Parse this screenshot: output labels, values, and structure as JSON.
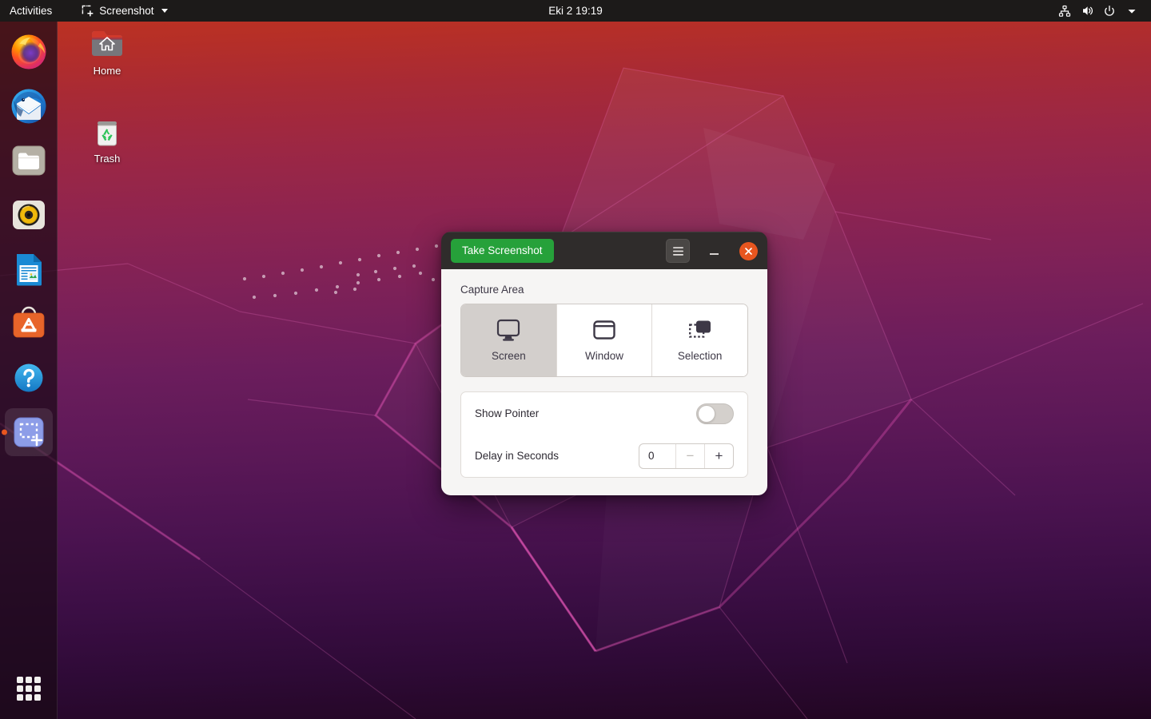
{
  "topbar": {
    "activities_label": "Activities",
    "app_menu_label": "Screenshot",
    "app_menu_icon": "selection-crosshair-icon",
    "clock_label": "Eki 2  19:19",
    "tray_icons": [
      "network-wired-icon",
      "volume-icon",
      "power-icon",
      "chevron-down-icon"
    ]
  },
  "dock": {
    "items": [
      {
        "name": "firefox",
        "label": "Firefox",
        "running": false
      },
      {
        "name": "thunderbird",
        "label": "Thunderbird Mail",
        "running": false
      },
      {
        "name": "files",
        "label": "Files",
        "running": false
      },
      {
        "name": "rhythmbox",
        "label": "Rhythmbox",
        "running": false
      },
      {
        "name": "libreoffice-writer",
        "label": "LibreOffice Writer",
        "running": false
      },
      {
        "name": "ubuntu-software",
        "label": "Ubuntu Software",
        "running": false
      },
      {
        "name": "help",
        "label": "Help",
        "running": false
      },
      {
        "name": "screenshot",
        "label": "Screenshot",
        "running": true
      }
    ],
    "show_apps_label": "Show Applications",
    "show_apps_icon": "app-grid-icon",
    "running_indicator_color": "#e8561f"
  },
  "desktop": {
    "icons": [
      {
        "name": "home",
        "label": "Home",
        "icon": "home-folder-icon"
      },
      {
        "name": "trash",
        "label": "Trash",
        "icon": "trash-bin-icon"
      }
    ]
  },
  "window": {
    "title": "Screenshot",
    "take_screenshot_label": "Take Screenshot",
    "take_screenshot_color": "#26a13a",
    "menu_icon": "hamburger-menu-icon",
    "minimize_icon": "minimize-icon",
    "close_icon": "close-icon",
    "close_color": "#e8561f",
    "capture_area": {
      "label": "Capture Area",
      "options": [
        {
          "name": "screen",
          "label": "Screen",
          "icon": "monitor-icon",
          "selected": true
        },
        {
          "name": "window",
          "label": "Window",
          "icon": "window-icon",
          "selected": false
        },
        {
          "name": "selection",
          "label": "Selection",
          "icon": "selection-icon",
          "selected": false
        }
      ]
    },
    "options": {
      "show_pointer": {
        "label": "Show Pointer",
        "value": "off"
      },
      "delay": {
        "label": "Delay in Seconds",
        "value": "0",
        "minus": "−",
        "plus": "+"
      }
    }
  }
}
